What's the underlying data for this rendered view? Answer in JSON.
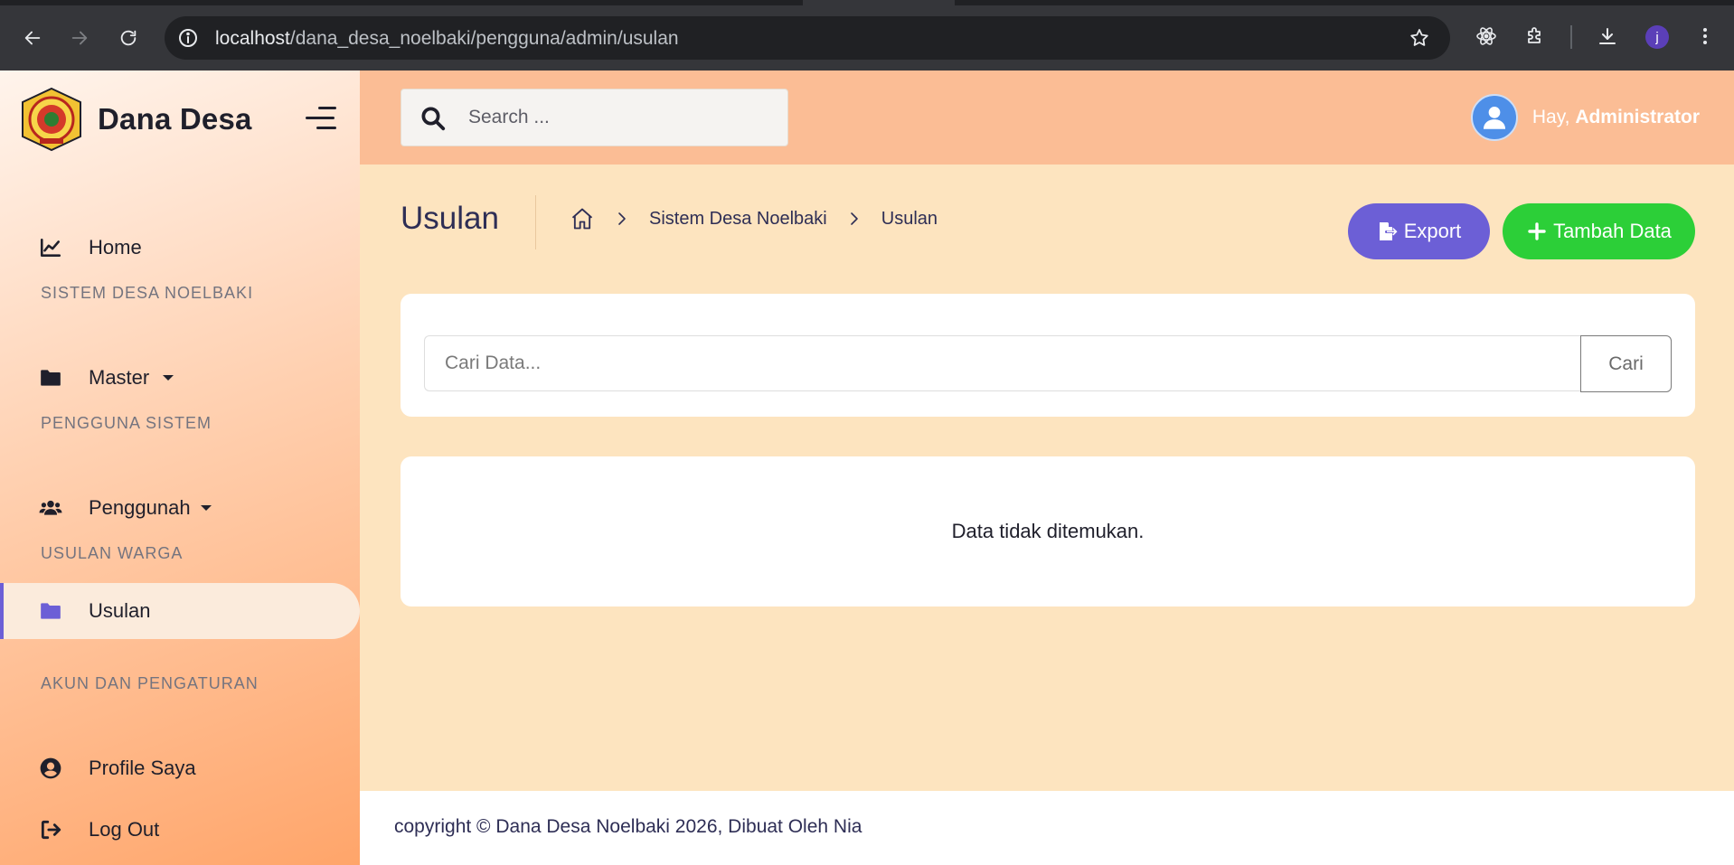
{
  "browser": {
    "url_host": "localhost",
    "url_path": "/dana_desa_noelbaki/pengguna/admin/usulan",
    "profile_initial": "j"
  },
  "brand": {
    "name": "Dana Desa"
  },
  "sidebar": {
    "home": "Home",
    "section_sistem": "SISTEM DESA NOELBAKI",
    "master": "Master",
    "section_pengguna": "PENGGUNA SISTEM",
    "penggunah": "Penggunah",
    "section_usulan": "USULAN WARGA",
    "usulan": "Usulan",
    "section_akun": "AKUN DAN PENGATURAN",
    "profile": "Profile Saya",
    "logout": "Log Out"
  },
  "topbar": {
    "search_placeholder": "Search ...",
    "greeting": "Hay,",
    "user_name": "Administrator"
  },
  "page": {
    "title": "Usulan",
    "breadcrumb": [
      "Sistem Desa Noelbaki",
      "Usulan"
    ],
    "export_label": "Export",
    "add_label": "Tambah Data",
    "filter_placeholder": "Cari Data...",
    "filter_button": "Cari",
    "empty_message": "Data tidak ditemukan."
  },
  "footer": {
    "text": "copyright © Dana Desa Noelbaki 2026, Dibuat Oleh Nia"
  },
  "colors": {
    "accent": "#6c5fd6",
    "add_button": "#2ccf38",
    "topbar": "#fbbd95",
    "content_bg": "#fde4bf"
  }
}
